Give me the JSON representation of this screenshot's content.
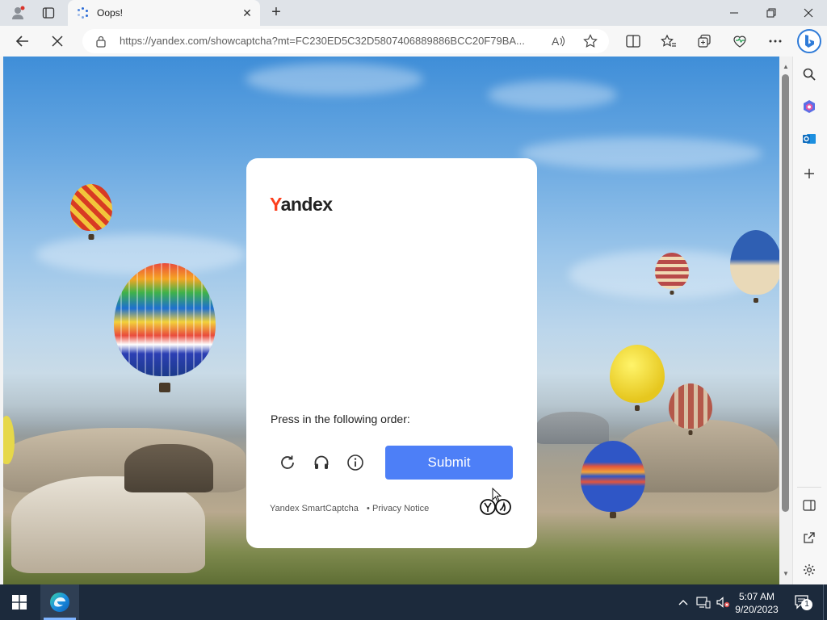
{
  "browser": {
    "tab_title": "Oops!",
    "url": "https://yandex.com/showcaptcha?mt=FC230ED5C32D5807406889886BCC20F79BA..."
  },
  "captcha": {
    "logo_first_letter": "Y",
    "logo_rest": "andex",
    "instruction": "Press in the following order:",
    "submit_label": "Submit",
    "footer_brand": "Yandex SmartCaptcha",
    "footer_separator": "•",
    "footer_privacy": "Privacy Notice"
  },
  "taskbar": {
    "time": "5:07 AM",
    "date": "9/20/2023",
    "notification_count": "1"
  },
  "colors": {
    "submit": "#4d7ff7",
    "yandex_red": "#fc3f1d",
    "taskbar": "#1c2a3c"
  }
}
